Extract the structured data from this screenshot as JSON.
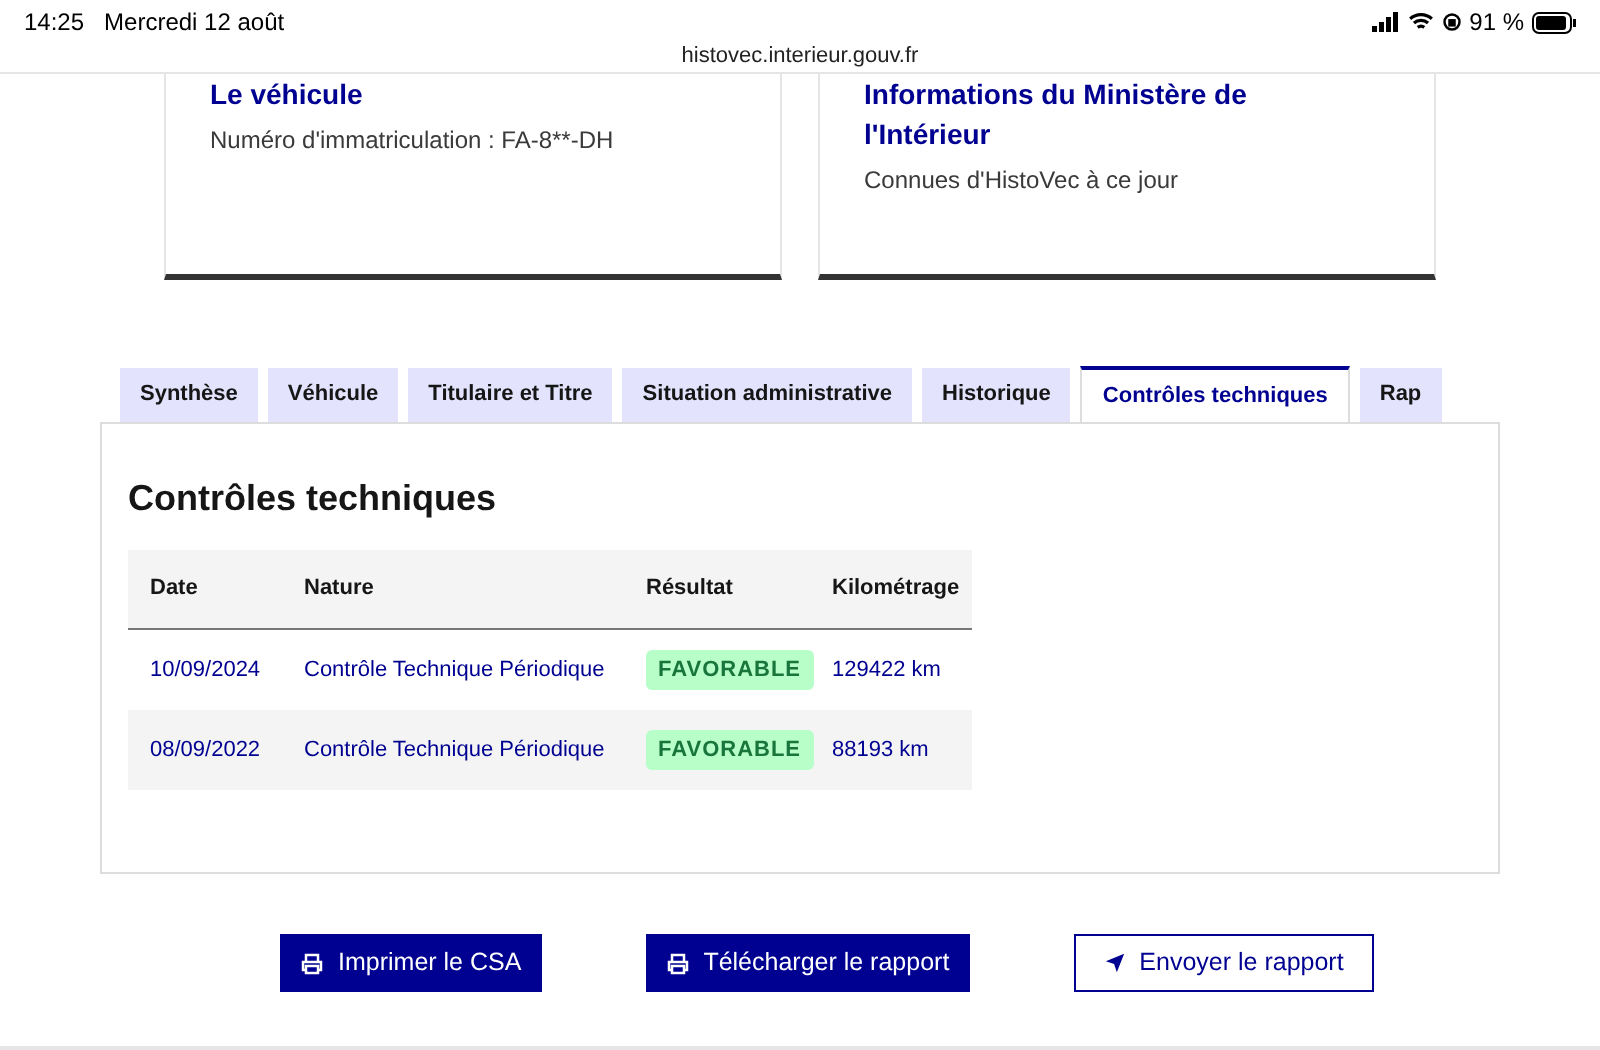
{
  "status_bar": {
    "time": "14:25",
    "date": "Mercredi 12 août",
    "battery": "91 %"
  },
  "address_bar": {
    "url": "histovec.interieur.gouv.fr"
  },
  "cards": [
    {
      "title_lines": [
        "Le véhicule"
      ],
      "text": "Numéro d'immatriculation : FA-8**-DH"
    },
    {
      "title_lines": [
        "Informations du Ministère de",
        "l'Intérieur"
      ],
      "text": "Connues d'HistoVec à ce jour"
    }
  ],
  "tabs": [
    {
      "label": "Synthèse",
      "selected": false
    },
    {
      "label": "Véhicule",
      "selected": false
    },
    {
      "label": "Titulaire et Titre",
      "selected": false
    },
    {
      "label": "Situation administrative",
      "selected": false
    },
    {
      "label": "Historique",
      "selected": false
    },
    {
      "label": "Contrôles techniques",
      "selected": true
    },
    {
      "label": "Rap",
      "selected": false
    }
  ],
  "panel": {
    "title": "Contrôles techniques",
    "table": {
      "columns": [
        "Date",
        "Nature",
        "Résultat",
        "Kilométrage"
      ],
      "rows": [
        {
          "date": "10/09/2024",
          "nature": "Contrôle Technique Périodique",
          "result": "FAVORABLE",
          "mileage": "129422 km"
        },
        {
          "date": "08/09/2022",
          "nature": "Contrôle Technique Périodique",
          "result": "FAVORABLE",
          "mileage": "88193 km"
        }
      ]
    }
  },
  "actions": [
    {
      "label": "Imprimer le CSA",
      "kind": "print",
      "primary": true
    },
    {
      "label": "Télécharger le rapport",
      "kind": "print",
      "primary": true
    },
    {
      "label": "Envoyer le rapport",
      "kind": "send",
      "primary": false
    }
  ]
}
